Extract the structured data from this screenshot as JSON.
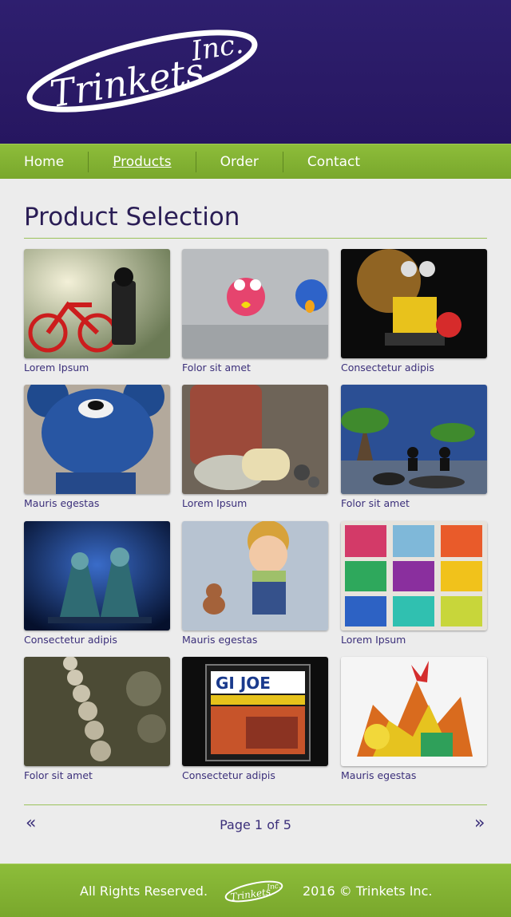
{
  "brand": {
    "logo_text": "Trinkets Inc.",
    "primary_color": "#2e1f6f",
    "accent_color": "#86b534"
  },
  "nav": [
    {
      "label": "Home",
      "active": false
    },
    {
      "label": "Products",
      "active": true
    },
    {
      "label": "Order",
      "active": false
    },
    {
      "label": "Contact",
      "active": false
    }
  ],
  "main": {
    "title": "Product Selection",
    "products": [
      {
        "caption": "Lorem Ipsum",
        "image": "lego-bicycle-photo"
      },
      {
        "caption": "Folor sit amet",
        "image": "puffer-fish-toys-photo"
      },
      {
        "caption": "Consectetur adipis",
        "image": "wall-e-toy-photo"
      },
      {
        "caption": "Mauris egestas",
        "image": "blue-bear-toy-photo"
      },
      {
        "caption": "Lorem Ipsum",
        "image": "figure-with-money-photo"
      },
      {
        "caption": "Folor sit amet",
        "image": "lego-soldiers-photo"
      },
      {
        "caption": "Consectetur adipis",
        "image": "daleks-photo"
      },
      {
        "caption": "Mauris egestas",
        "image": "doll-with-dog-photo"
      },
      {
        "caption": "Lorem Ipsum",
        "image": "toy-box-compartments-photo"
      },
      {
        "caption": "Folor sit amet",
        "image": "magnetic-balls-photo"
      },
      {
        "caption": "Consectetur adipis",
        "image": "gi-joe-box-photo"
      },
      {
        "caption": "Mauris egestas",
        "image": "bead-sculpture-photo"
      }
    ]
  },
  "pager": {
    "prev": "«",
    "label": "Page 1 of 5",
    "next": "»"
  },
  "footer": {
    "left": "All Rights Reserved.",
    "right": "2016 © Trinkets Inc."
  }
}
